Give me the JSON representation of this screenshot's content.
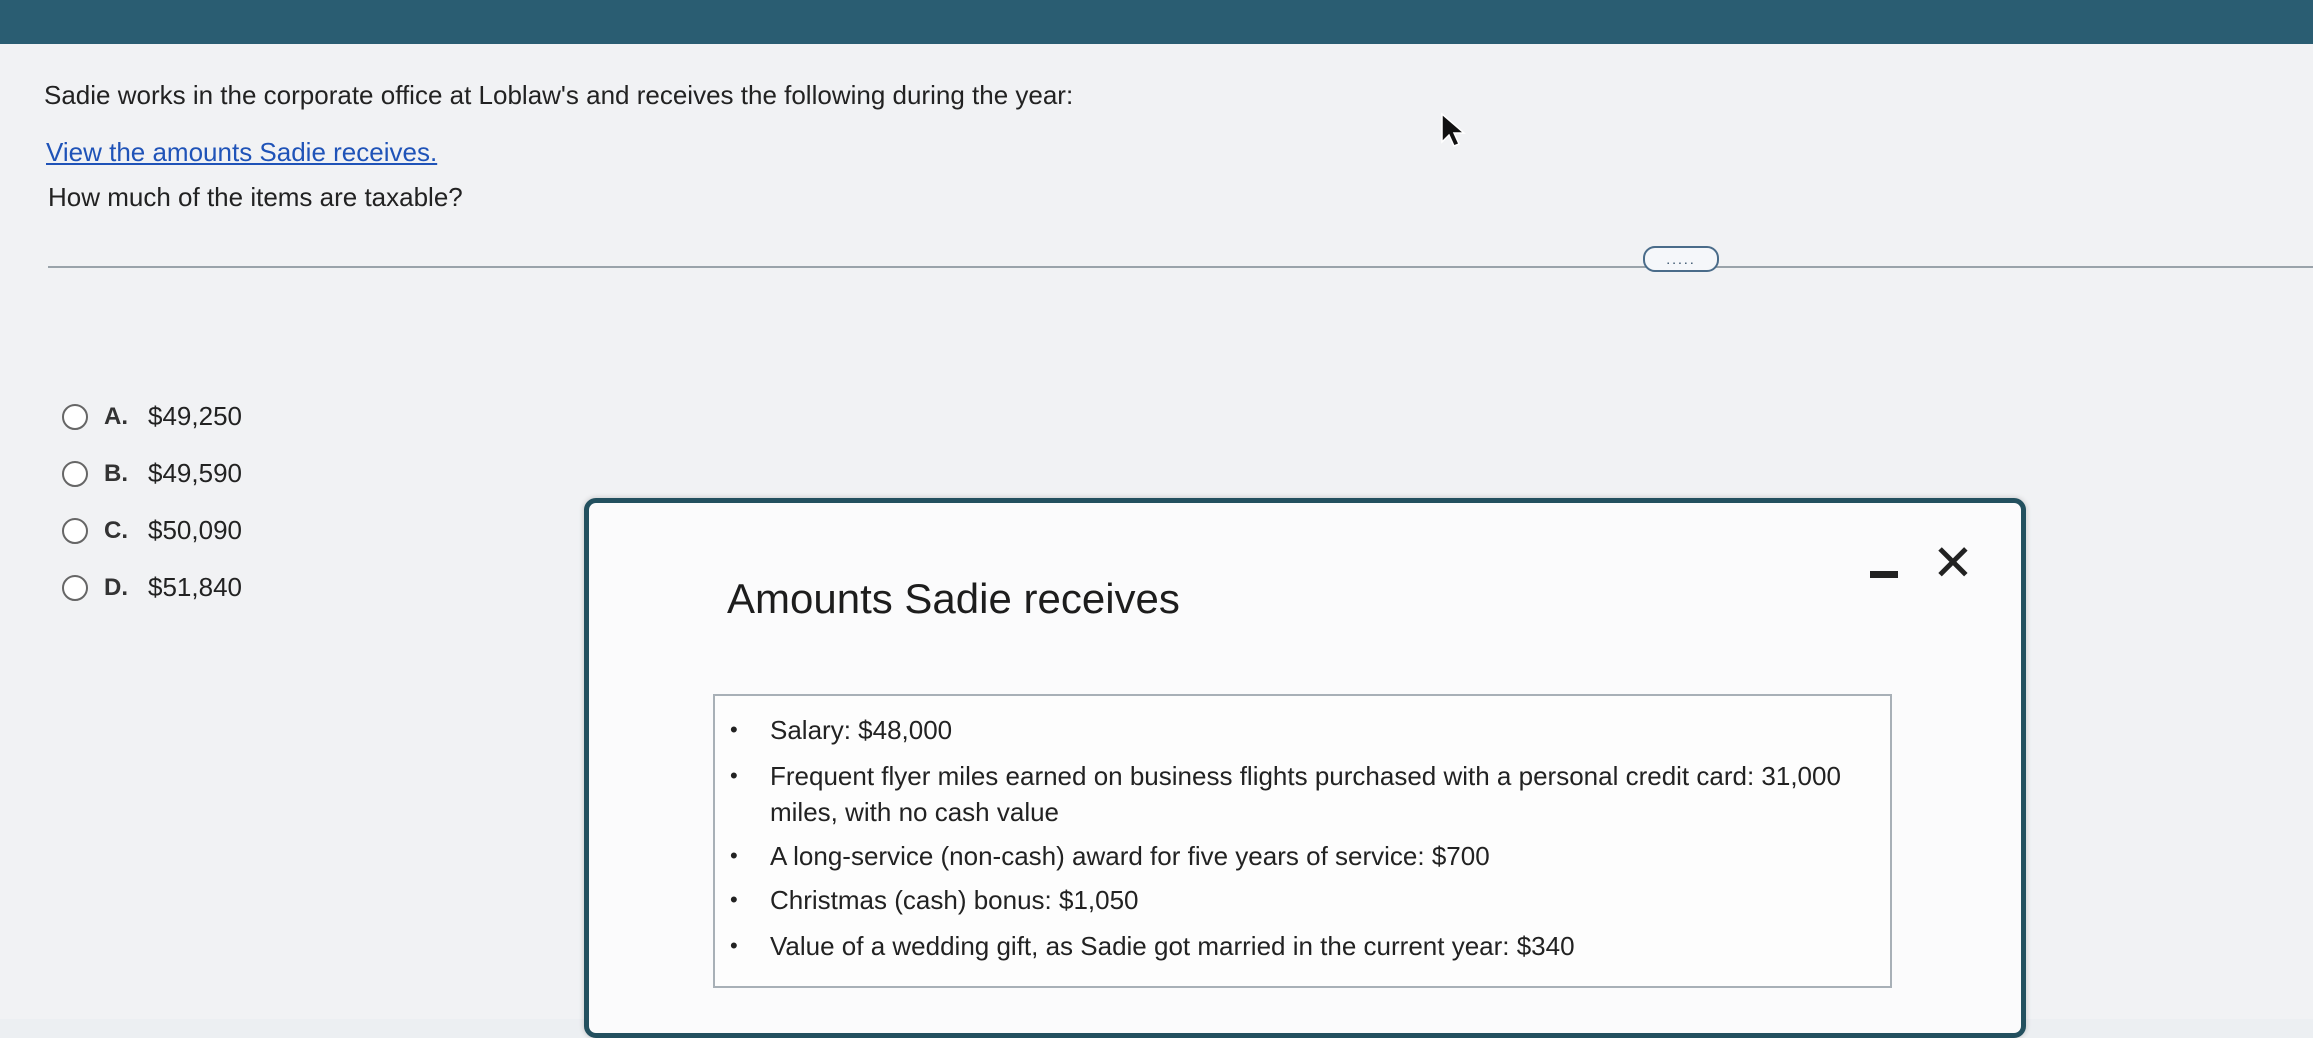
{
  "question": {
    "text": "Sadie works in the corporate office at Loblaw's and receives the following during the year:",
    "link": "View the amounts Sadie receives.",
    "prompt": "How much of the items are taxable?",
    "more_label": "....."
  },
  "options": [
    {
      "letter": "A.",
      "value": "$49,250"
    },
    {
      "letter": "B.",
      "value": "$49,590"
    },
    {
      "letter": "C.",
      "value": "$50,090"
    },
    {
      "letter": "D.",
      "value": "$51,840"
    }
  ],
  "dialog": {
    "title": "Amounts Sadie receives",
    "close_label": "✕",
    "items": [
      "Salary: $48,000",
      "Frequent flyer miles earned on business flights purchased with a personal credit card: 31,000 miles, with no cash value",
      "A long-service (non-cash) award for five years of service: $700",
      "Christmas (cash) bonus: $1,050",
      "Value of a wedding gift, as Sadie got married in the current year: $340"
    ]
  },
  "icons": {
    "radio": "radio-empty-icon",
    "minimize": "minimize-icon",
    "close": "close-icon",
    "cursor": "mouse-cursor-icon"
  }
}
